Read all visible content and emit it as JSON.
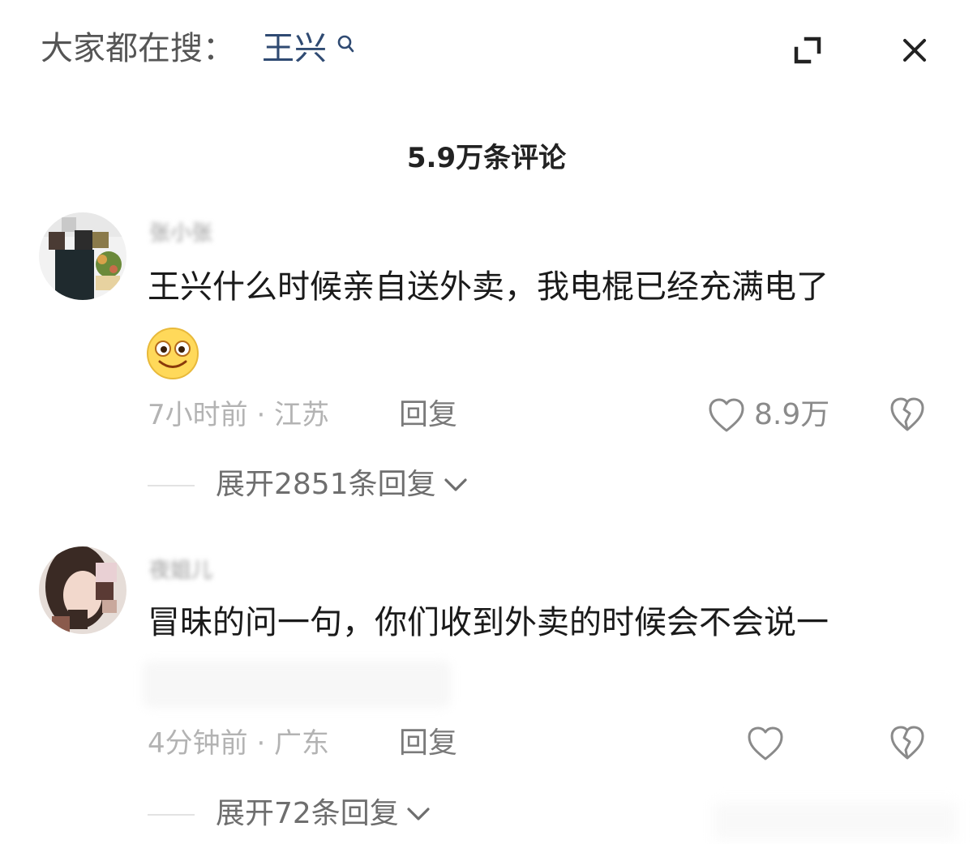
{
  "header": {
    "search_prompt": "大家都在搜：",
    "search_term": "王兴",
    "search_icon": "search-icon",
    "expand_icon": "expand-icon",
    "close_icon": "close-icon"
  },
  "comments_count_title": "5.9万条评论",
  "comments": [
    {
      "username": "张小张",
      "text_line1": "王兴什么时候亲自送外卖，我电棍已经充满电了",
      "emoji": "smiley-emoji",
      "time": "7小时前",
      "location": "江苏",
      "meta": "7小时前 · 江苏",
      "reply_label": "回复",
      "likes": "8.9万",
      "expand_label": "展开2851条回复"
    },
    {
      "username": "夜姐儿",
      "text_line1": "冒昧的问一句，你们收到外卖的时候会不会说一",
      "time": "4分钟前",
      "location": "广东",
      "meta": "4分钟前 · 广东",
      "reply_label": "回复",
      "likes": "",
      "expand_label": "展开72条回复"
    }
  ],
  "colors": {
    "search_term": "#2f4a72",
    "text_primary": "#1a1a1a",
    "text_muted": "#b3b3b3",
    "text_secondary": "#6e6e6e"
  }
}
